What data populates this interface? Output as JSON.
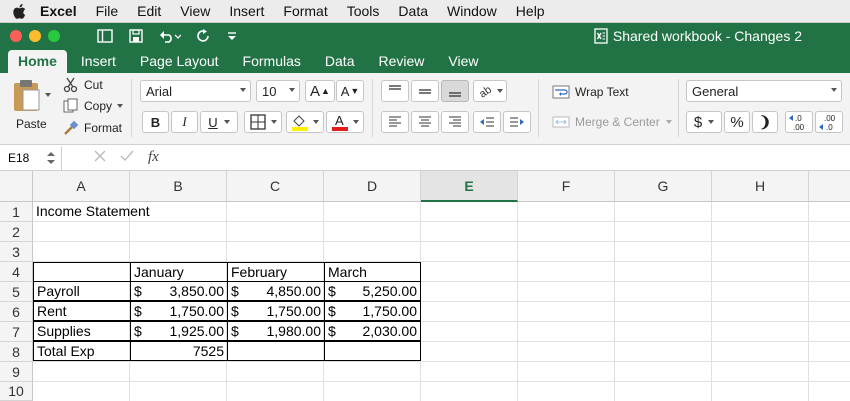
{
  "menubar": {
    "app": "Excel",
    "items": [
      "File",
      "Edit",
      "View",
      "Insert",
      "Format",
      "Tools",
      "Data",
      "Window",
      "Help"
    ]
  },
  "titlebar": {
    "title": "Shared workbook - Changes 2"
  },
  "tabs": [
    "Home",
    "Insert",
    "Page Layout",
    "Formulas",
    "Data",
    "Review",
    "View"
  ],
  "ribbon": {
    "paste": "Paste",
    "cut": "Cut",
    "copy": "Copy",
    "format": "Format",
    "font_name": "Arial",
    "font_size": "10",
    "bold": "B",
    "italic": "I",
    "underline": "U",
    "wrap_text": "Wrap Text",
    "merge_center": "Merge & Center",
    "number_format": "General",
    "dollar": "$",
    "percent": "%",
    "comma": "❩",
    "inc_decimal": ".0\n.00",
    "dec_decimal": ".00\n.0"
  },
  "formula_bar": {
    "name_box": "E18",
    "fx": "fx",
    "value": ""
  },
  "columns": [
    "A",
    "B",
    "C",
    "D",
    "E",
    "F",
    "G",
    "H"
  ],
  "active_column": "E",
  "rows": [
    "1",
    "2",
    "3",
    "4",
    "5",
    "6",
    "7",
    "8",
    "9",
    "10"
  ],
  "sheet": {
    "title": "Income Statement",
    "months": [
      "January",
      "February",
      "March"
    ],
    "currency": "$",
    "lines": [
      {
        "label": "Payroll",
        "values": [
          "3,850.00",
          "4,850.00",
          "5,250.00"
        ]
      },
      {
        "label": "Rent",
        "values": [
          "1,750.00",
          "1,750.00",
          "1,750.00"
        ]
      },
      {
        "label": "Supplies",
        "values": [
          "1,925.00",
          "1,980.00",
          "2,030.00"
        ]
      }
    ],
    "total_label": "Total Exp",
    "total_value": "7525"
  }
}
